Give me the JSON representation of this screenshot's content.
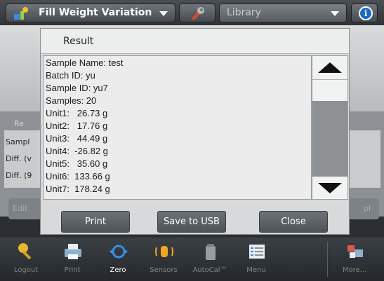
{
  "header": {
    "app_name": "Fill Weight Variation",
    "library_label": "Library",
    "info_symbol": "i"
  },
  "background": {
    "results_label": "Re",
    "side_labels": [
      "Sampl",
      "Diff. (v",
      "Diff. (9"
    ],
    "left_button": "Edit",
    "right_button": "pl"
  },
  "dialog": {
    "title": "Result",
    "lines": [
      "Sample Name: test",
      "Batch ID: yu",
      "Sample ID: yu7",
      "Samples: 20",
      "Unit1:   26.73 g",
      "Unit2:   17.76 g",
      "Unit3:   44.49 g",
      "Unit4:  -26.82 g",
      "Unit5:   35.60 g",
      "Unit6:  133.66 g",
      "Unit7:  178.24 g"
    ],
    "buttons": {
      "print": "Print",
      "save": "Save to USB",
      "close": "Close"
    }
  },
  "taskbar": {
    "items": [
      "Logout",
      "Print",
      "Zero",
      "Sensors",
      "AutoCal™",
      "Menu",
      "More..."
    ]
  },
  "colors": {
    "accent_blue": "#1a68c8",
    "dialog_bg": "#d8d9da",
    "taskbar_bg": "#2b2f33"
  }
}
